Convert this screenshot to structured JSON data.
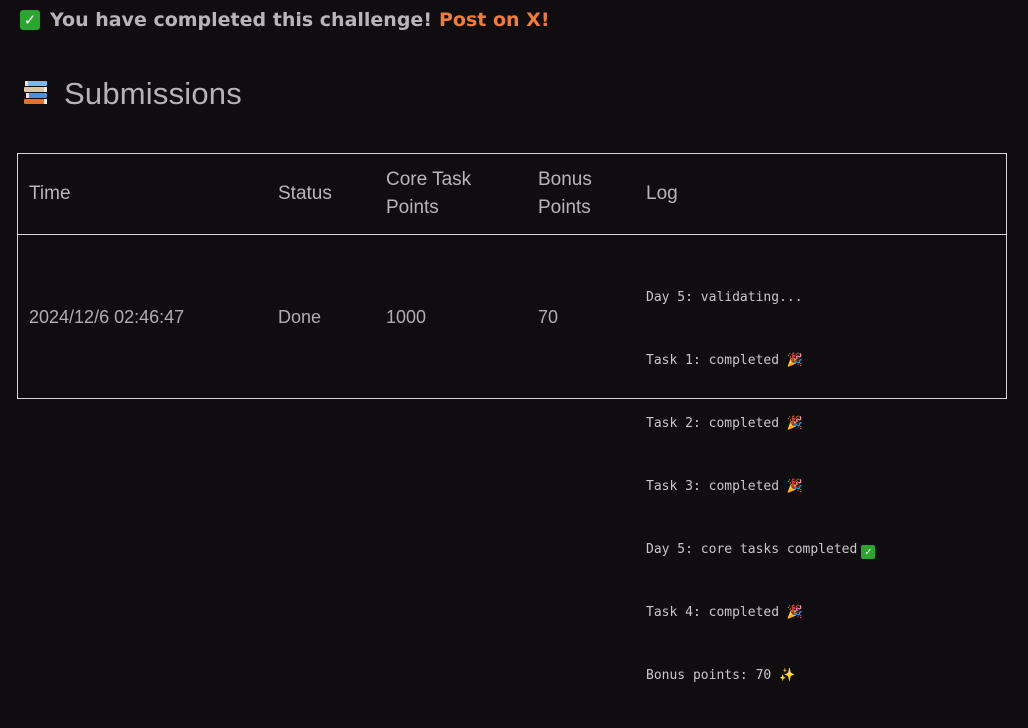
{
  "banner": {
    "check_icon": "check-mark-button-icon",
    "message": "You have completed this challenge!",
    "post_link": "Post on X!"
  },
  "submissions": {
    "icon": "books-icon",
    "title": "Submissions",
    "columns": {
      "time": "Time",
      "status": "Status",
      "core_line1": "Core Task",
      "core_line2": "Points",
      "bonus_line1": "Bonus",
      "bonus_line2": "Points",
      "log": "Log"
    },
    "rows": [
      {
        "time": "2024/12/6 02:46:47",
        "status": "Done",
        "core_points": "1000",
        "bonus_points": "70",
        "log": [
          {
            "text": "Day 5: validating...",
            "icon": ""
          },
          {
            "text": "Task 1: completed",
            "icon": "party-popper-icon"
          },
          {
            "text": "Task 2: completed",
            "icon": "party-popper-icon"
          },
          {
            "text": "Task 3: completed",
            "icon": "party-popper-icon"
          },
          {
            "text": "Day 5: core tasks completed",
            "icon": "check-mark-button-icon"
          },
          {
            "text": "Task 4: completed",
            "icon": "party-popper-icon"
          },
          {
            "text": "Bonus points: 70",
            "icon": "sparkles-icon"
          }
        ]
      }
    ]
  },
  "colors": {
    "background": "#0f0d10",
    "accent_orange": "#f07c3b",
    "check_green": "#2aa52e",
    "border": "#d8d6d8"
  }
}
